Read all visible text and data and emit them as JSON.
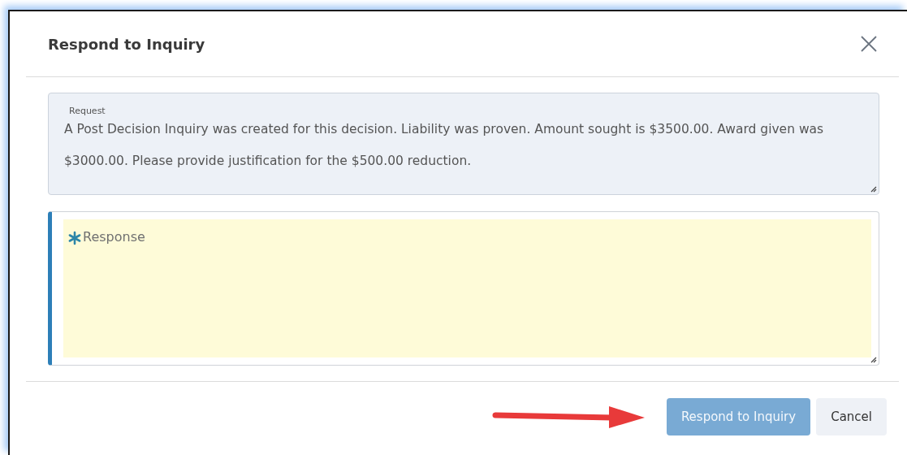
{
  "dialog": {
    "title": "Respond to Inquiry"
  },
  "request": {
    "label": "Request",
    "value": "A Post Decision Inquiry was created for this decision.  Liability was proven.  Amount sought is $3500.00.  Award given was $3000.00.  Please provide justification for the $500.00 reduction."
  },
  "response": {
    "placeholder": "Response",
    "required": true
  },
  "buttons": [
    {
      "kind": "primary",
      "label": "Respond to Inquiry",
      "disabled": true
    },
    {
      "kind": "secondary",
      "label": "Cancel",
      "disabled": false
    }
  ],
  "annotation": {
    "kind": "arrow"
  }
}
